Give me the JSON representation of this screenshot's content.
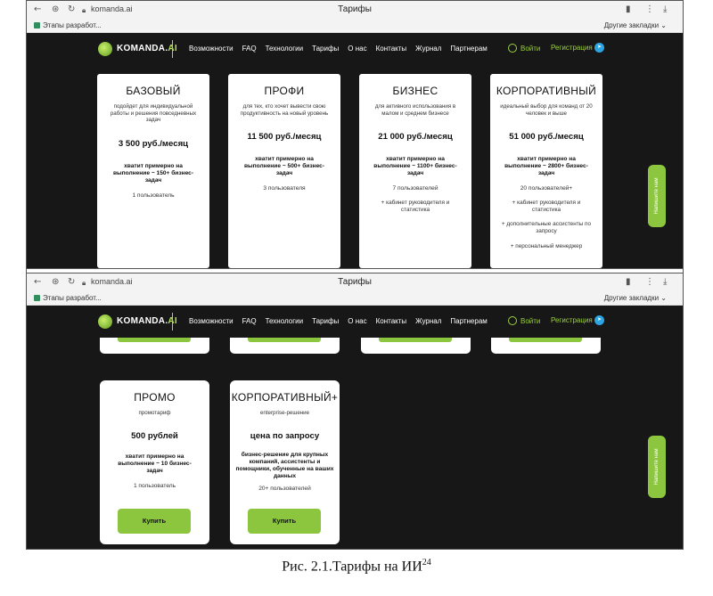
{
  "browser": {
    "address": "komanda.ai",
    "tab_title": "Тарифы",
    "bookmark": "Этапы разработ...",
    "other_bookmarks": "Другие закладки"
  },
  "site": {
    "logo_main": "KOMANDA.",
    "logo_ai": "AI",
    "menu": [
      "Возможности",
      "FAQ",
      "Технологии",
      "Тарифы",
      "О нас",
      "Контакты",
      "Журнал",
      "Партнерам"
    ],
    "login": "Войти",
    "register": "Регистрация",
    "side_tab": "Напишите нам"
  },
  "plans_top": [
    {
      "name": "БАЗОВЫЙ",
      "desc": "подойдет для индивидуальной работы и решения повседневных задач",
      "price": "3 500 руб./месяц",
      "tasks": "хватит примерно на выполнение ~ 150+ бизнес-задач",
      "users": "1 пользователь",
      "extras": []
    },
    {
      "name": "ПРОФИ",
      "desc": "для тех, кто хочет вывести свою продуктивность на новый уровень",
      "price": "11 500 руб./месяц",
      "tasks": "хватит примерно на выполнение ~ 500+ бизнес-задач",
      "users": "3 пользователя",
      "extras": []
    },
    {
      "name": "БИЗНЕС",
      "desc": "для активного использования в малом и среднем бизнесе",
      "price": "21 000 руб./месяц",
      "tasks": "хватит примерно на выполнение ~ 1100+ бизнес-задач",
      "users": "7 пользователей",
      "extras": [
        "+ кабинет руководителя и статистика"
      ]
    },
    {
      "name": "КОРПОРАТИВНЫЙ",
      "desc": "идеальный выбор для команд от 20 человек и выше",
      "price": "51 000 руб./месяц",
      "tasks": "хватит примерно на выполнение ~ 2800+ бизнес-задач",
      "users": "20 пользователей+",
      "extras": [
        "+ кабинет руководителя и статистика",
        "+ дополнительные ассистенты по запросу",
        "+ персональный менеджер"
      ]
    }
  ],
  "plans_bottom": [
    {
      "name": "ПРОМО",
      "desc": "промотариф",
      "price": "500 рублей",
      "tasks": "хватит примерно на выполнение ~ 10 бизнес-задач",
      "users": "1 пользователь",
      "button": "Купить"
    },
    {
      "name": "КОРПОРАТИВНЫЙ+",
      "desc": "enterprise-решение",
      "price": "цена по запросу",
      "tasks": "бизнес-решение для крупных компаний, ассистенты и помощники, обученные на ваших данных",
      "users": "20+ пользователей",
      "button": "Купить"
    }
  ],
  "caption": {
    "text": "Рис. 2.1.Тарифы на ИИ",
    "sup": "24"
  },
  "colors": {
    "accent": "#8cc63f",
    "background": "#171717",
    "card": "#ffffff",
    "telegram": "#2ca5e0"
  }
}
